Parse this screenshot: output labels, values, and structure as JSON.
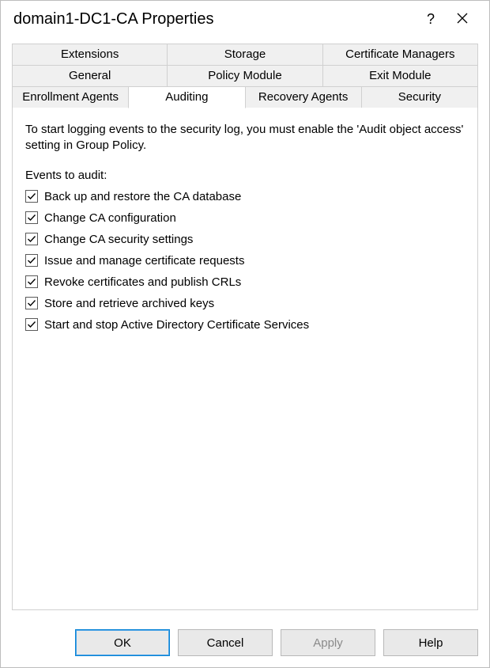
{
  "window": {
    "title": "domain1-DC1-CA Properties",
    "help_glyph": "?",
    "close_label": "Close"
  },
  "tabs": {
    "row1": [
      "Extensions",
      "Storage",
      "Certificate Managers"
    ],
    "row2": [
      "General",
      "Policy Module",
      "Exit Module"
    ],
    "row3": [
      "Enrollment Agents",
      "Auditing",
      "Recovery Agents",
      "Security"
    ],
    "active": "Auditing"
  },
  "panel": {
    "description": "To start logging events to the security log, you must enable the 'Audit object access' setting in Group Policy.",
    "subhead": "Events to audit:",
    "checks": [
      {
        "label": "Back up and restore the CA database",
        "checked": true
      },
      {
        "label": "Change CA configuration",
        "checked": true
      },
      {
        "label": "Change CA security settings",
        "checked": true
      },
      {
        "label": "Issue and manage certificate requests",
        "checked": true
      },
      {
        "label": "Revoke certificates and publish CRLs",
        "checked": true
      },
      {
        "label": "Store and retrieve archived keys",
        "checked": true
      },
      {
        "label": "Start and stop Active Directory Certificate Services",
        "checked": true
      }
    ]
  },
  "buttons": {
    "ok": "OK",
    "cancel": "Cancel",
    "apply": "Apply",
    "help": "Help"
  }
}
